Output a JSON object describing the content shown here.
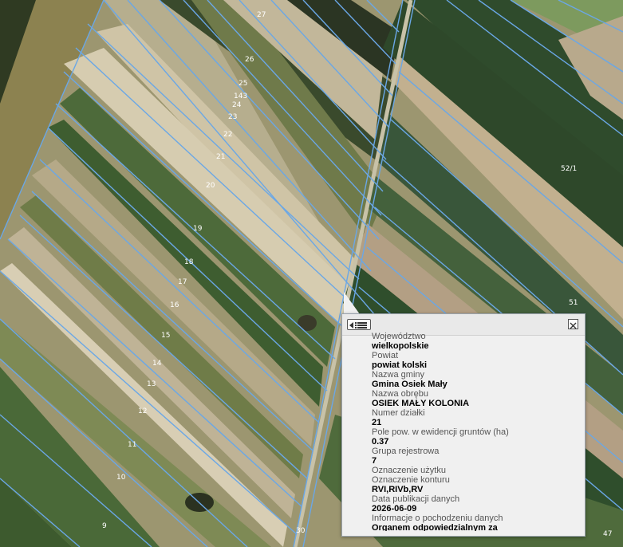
{
  "map": {
    "parcel_labels": [
      "27",
      "26",
      "25",
      "143",
      "24",
      "23",
      "22",
      "21",
      "20",
      "19",
      "18",
      "17",
      "16",
      "15",
      "14",
      "13",
      "12",
      "11",
      "10",
      "9",
      "30",
      "52/1",
      "51",
      "47"
    ],
    "colors": {
      "boundary": "#6aa7e6",
      "label": "#ffffff"
    }
  },
  "popup": {
    "menu_icon": "list-icon",
    "close_icon": "close-icon",
    "fields": [
      {
        "label": "Województwo",
        "value": "wielkopolskie"
      },
      {
        "label": "Powiat",
        "value": "powiat kolski"
      },
      {
        "label": "Nazwa gminy",
        "value": "Gmina Osiek Mały"
      },
      {
        "label": "Nazwa obrębu",
        "value": "OSIEK MAŁY KOLONIA"
      },
      {
        "label": "Numer działki",
        "value": "21"
      },
      {
        "label": "Pole pow. w ewidencji gruntów (ha)",
        "value": "0.37"
      },
      {
        "label": "Grupa rejestrowa",
        "value": "7"
      },
      {
        "label": "Oznaczenie użytku",
        "value": ""
      },
      {
        "label": "Oznaczenie konturu",
        "value": "RVI,RIVb,RV"
      },
      {
        "label": "Data publikacji danych",
        "value": "2026-06-09"
      },
      {
        "label": "Informacje o pochodzeniu danych",
        "value": "Organem odpowiedzialnym za"
      }
    ]
  }
}
